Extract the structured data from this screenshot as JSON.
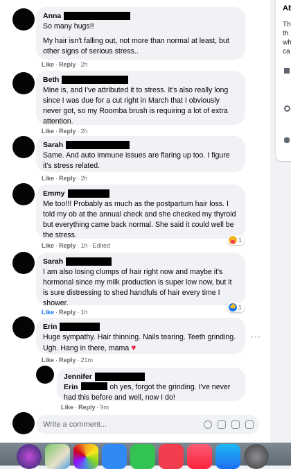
{
  "comments": [
    {
      "author": "Anna",
      "paragraphs": [
        "So many hugs!!",
        "My hair isn't falling out, not more than normal at least, but other signs of serious stress.."
      ],
      "like": "Like",
      "reply": "Reply",
      "time": "2h"
    },
    {
      "author": "Beth",
      "paragraphs": [
        "Mine is, and I've attributed it to stress. It's also really long since I was due for a cut right in March that I obviously never got, so my Roomba brush is requiring a lot of extra attention."
      ],
      "like": "Like",
      "reply": "Reply",
      "time": "2h"
    },
    {
      "author": "Sarah",
      "paragraphs": [
        "Same. And auto immune issues are flaring up too. I figure it's stress related."
      ],
      "like": "Like",
      "reply": "Reply",
      "time": "2h"
    },
    {
      "author": "Emmy",
      "paragraphs": [
        "Me too!!! Probably as much as the postpartum hair loss. I told my ob at the annual check and she checked my thyroid but everything came back normal. She said it could well be the stress."
      ],
      "like": "Like",
      "reply": "Reply",
      "time": "1h",
      "edited": "Edited",
      "reaction_count": "1"
    },
    {
      "author": "Sarah",
      "paragraphs": [
        "I am also losing clumps of hair right now and maybe it's hormonal since my milk production is super low now, but it is sure distressing to shed handfuls of hair every time I shower."
      ],
      "like": "Like",
      "reply": "Reply",
      "time": "1h",
      "reaction_count": "1"
    },
    {
      "author": "Erin",
      "paragraphs": [
        "Huge sympathy. Hair thinning. Nails tearing. Teeth grinding. Ugh. Hang in there, mama"
      ],
      "like": "Like",
      "reply": "Reply",
      "time": "21m"
    }
  ],
  "reply": {
    "author": "Jennifer",
    "mention": "Erin",
    "text": "oh yes, forgot the grinding. I've never had this before and well, now I do!",
    "like": "Like",
    "reply": "Reply",
    "time": "9m"
  },
  "composer": {
    "placeholder": "Write a comment..."
  },
  "sidepanel": {
    "title": "Ab",
    "lines": [
      "Th",
      "th",
      "wh",
      "ca"
    ]
  },
  "dock": {
    "apps": [
      "siri-icon",
      "maps-icon",
      "photos-icon",
      "messages-icon",
      "facetime-icon",
      "news-icon",
      "music-icon",
      "app-store-icon",
      "system-preferences-icon"
    ]
  },
  "colors": {
    "bubble": "#f0f2f5",
    "meta": "#65676b",
    "like_blue": "#1877f2",
    "heart": "#e41e3f"
  }
}
